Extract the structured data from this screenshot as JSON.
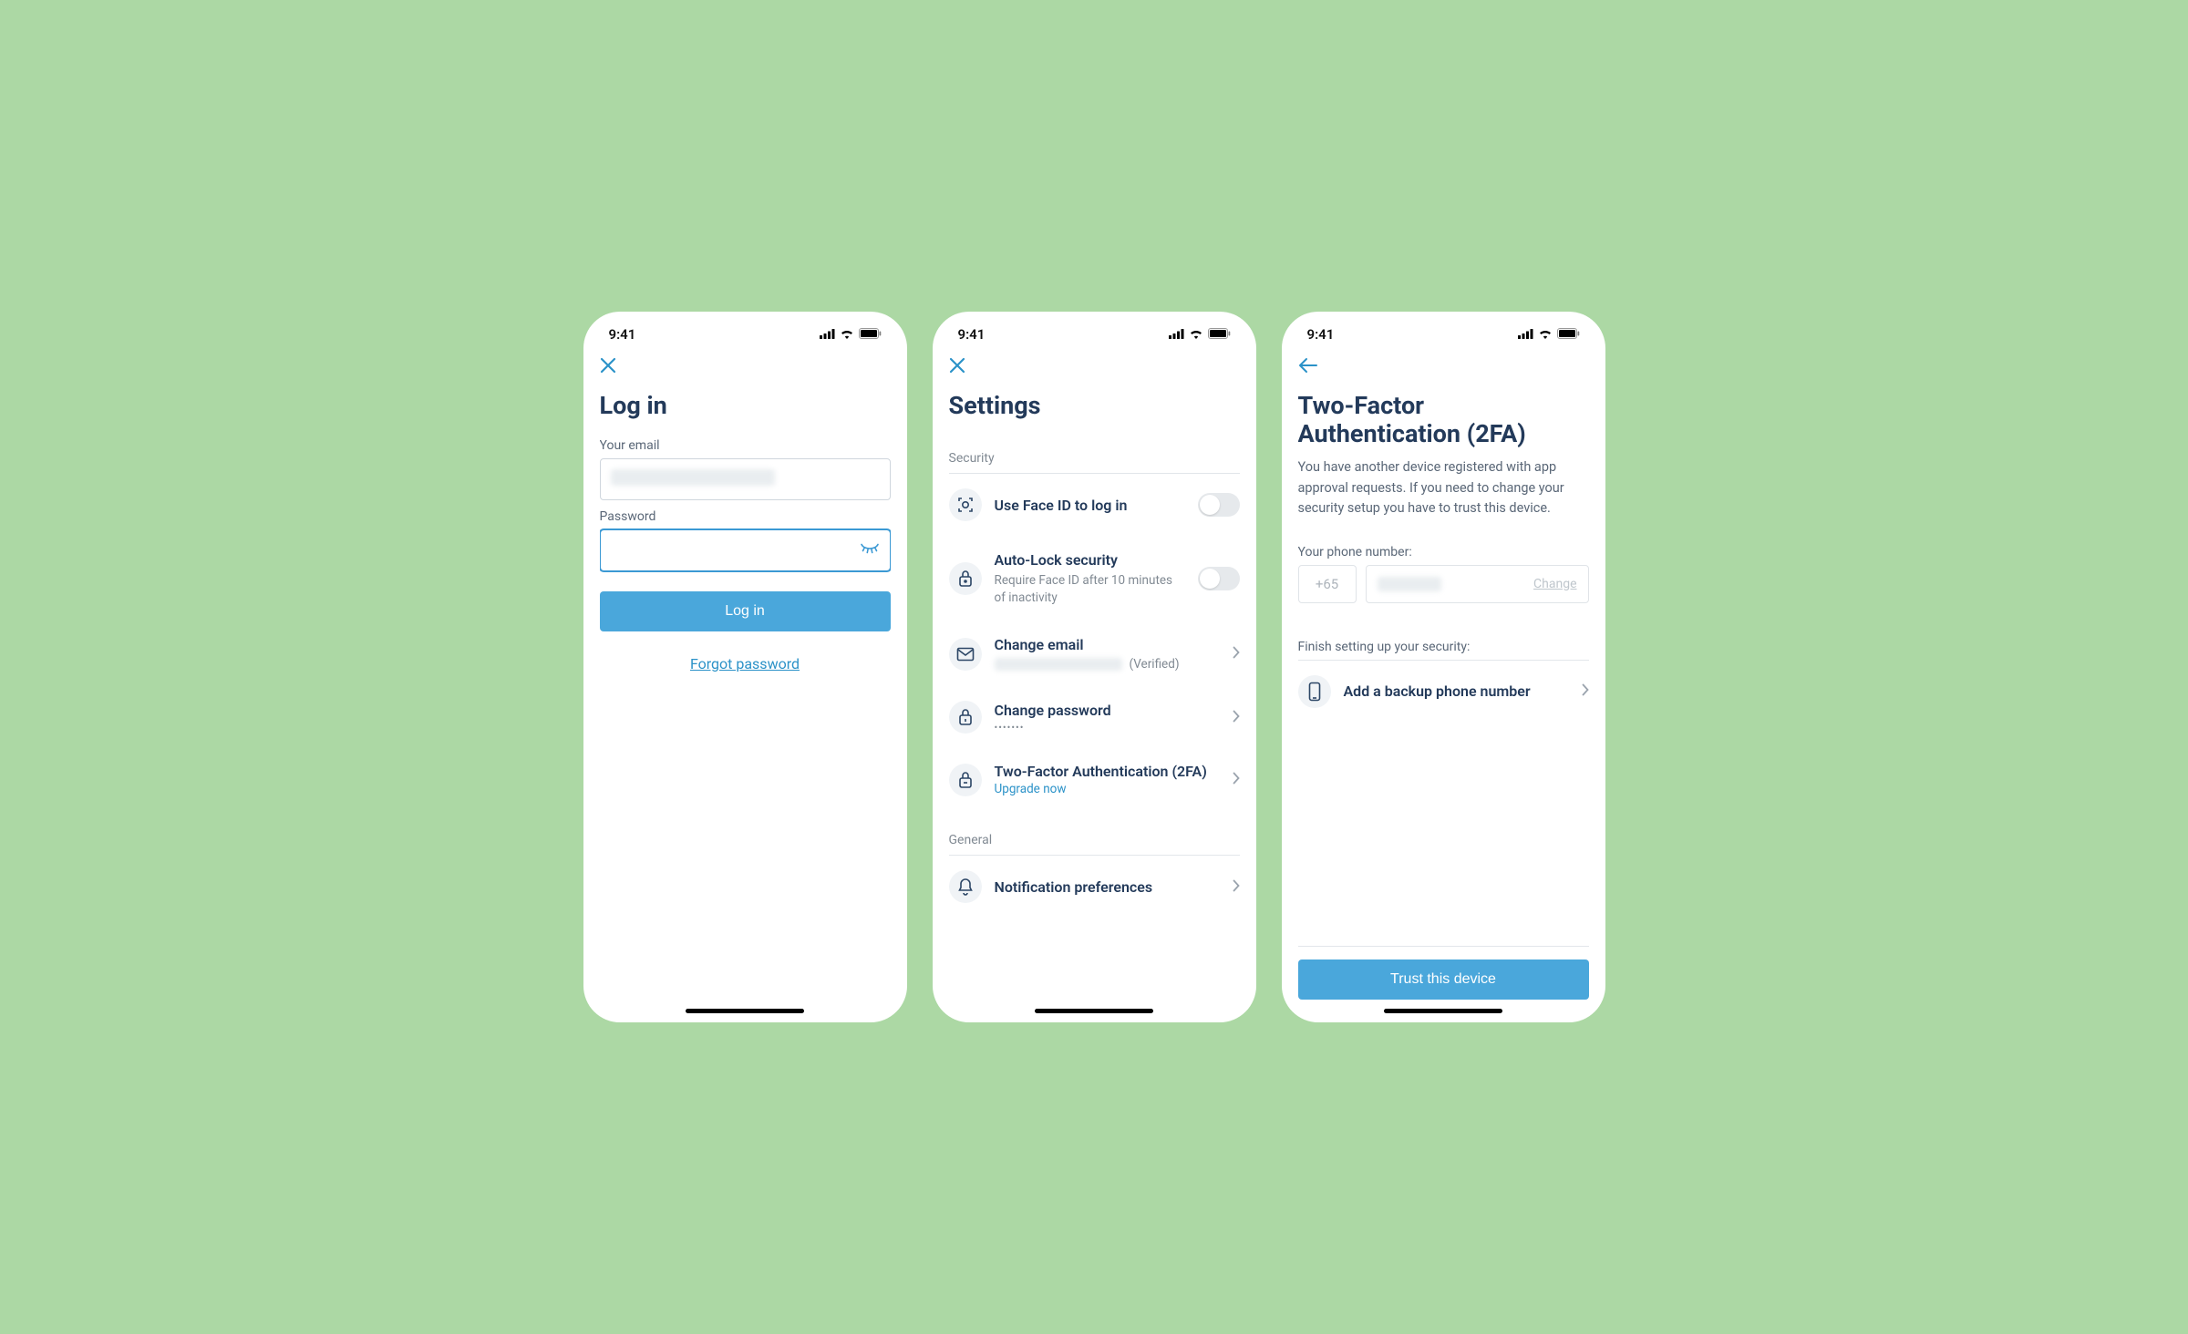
{
  "status": {
    "time": "9:41"
  },
  "login": {
    "title": "Log in",
    "email_label": "Your email",
    "password_label": "Password",
    "button": "Log in",
    "forgot": "Forgot password"
  },
  "settings": {
    "title": "Settings",
    "sections": {
      "security": "Security",
      "general": "General"
    },
    "faceid": {
      "title": "Use Face ID to log in"
    },
    "autolock": {
      "title": "Auto-Lock security",
      "sub": "Require Face ID after 10 minutes of inactivity"
    },
    "email": {
      "title": "Change email",
      "status": "(Verified)"
    },
    "password": {
      "title": "Change password",
      "masked": "•••••••"
    },
    "twofa": {
      "title": "Two-Factor Authentication (2FA)",
      "sub": "Upgrade now"
    },
    "notifications": {
      "title": "Notification preferences"
    }
  },
  "twofa": {
    "title": "Two-Factor Authentication (2FA)",
    "desc": "You have another device registered with app approval requests. If you need to change your security setup you have to trust this device.",
    "phone_label": "Your phone number:",
    "country_code": "+65",
    "change": "Change",
    "finish_label": "Finish setting up your security:",
    "backup": {
      "title": "Add a backup phone number"
    },
    "trust_button": "Trust this device"
  }
}
